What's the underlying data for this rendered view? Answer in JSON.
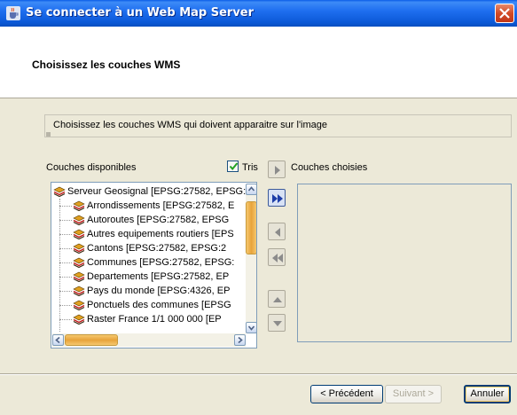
{
  "window": {
    "title": "Se connecter à un Web Map Server",
    "app_icon": "java-cup-icon",
    "close_icon": "close-icon"
  },
  "header": {
    "title": "Choisissez les couches WMS"
  },
  "description": "Choisissez les couches WMS qui doivent apparaitre sur l'image",
  "available": {
    "label": "Couches disponibles",
    "sort_label": "Tris",
    "sort_checked": true,
    "tree": [
      {
        "label": "Serveur Geosignal [EPSG:27582, EPSG:",
        "level": 0
      },
      {
        "label": "Arrondissements [EPSG:27582, E",
        "level": 1
      },
      {
        "label": "Autoroutes [EPSG:27582, EPSG",
        "level": 1
      },
      {
        "label": "Autres equipements routiers [EPS",
        "level": 1
      },
      {
        "label": "Cantons [EPSG:27582, EPSG:2",
        "level": 1
      },
      {
        "label": "Communes [EPSG:27582, EPSG:",
        "level": 1
      },
      {
        "label": "Departements [EPSG:27582, EP",
        "level": 1
      },
      {
        "label": "Pays du monde [EPSG:4326, EP",
        "level": 1
      },
      {
        "label": "Ponctuels des communes [EPSG",
        "level": 1
      },
      {
        "label": "Raster France 1/1 000 000 [EP",
        "level": 1
      }
    ],
    "layer_icon": "layers-icon"
  },
  "chosen": {
    "label": "Couches choisies",
    "items": []
  },
  "transfer_buttons": [
    {
      "name": "add-one-button",
      "icon": "arrow-right-icon"
    },
    {
      "name": "add-all-button",
      "icon": "double-arrow-right-icon"
    },
    {
      "name": "remove-one-button",
      "icon": "arrow-left-icon"
    },
    {
      "name": "remove-all-button",
      "icon": "double-arrow-left-icon"
    },
    {
      "name": "move-up-button",
      "icon": "arrow-up-icon"
    },
    {
      "name": "move-down-button",
      "icon": "arrow-down-icon"
    }
  ],
  "footer": {
    "previous": "< Précédent",
    "next": "Suivant >",
    "cancel": "Annuler"
  },
  "colors": {
    "titlebar": "#0a5ee8",
    "background": "#ece9d8",
    "accent_blue": "#1e3ea8",
    "scroll_thumb": "#e8a33a"
  }
}
